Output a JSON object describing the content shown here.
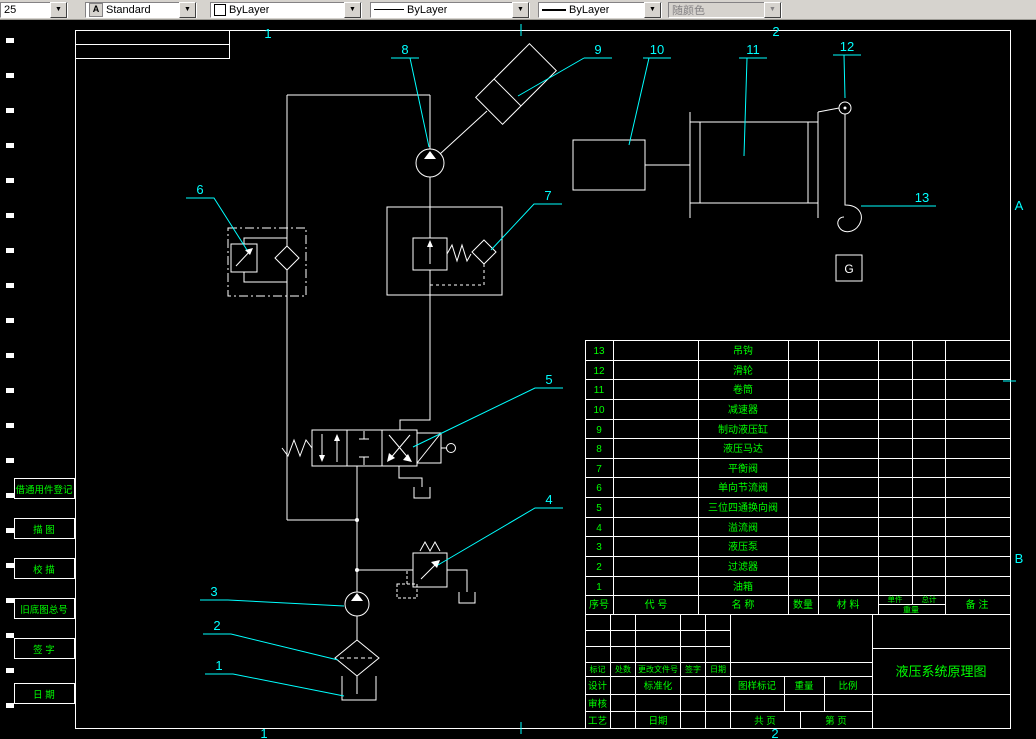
{
  "toolbar": {
    "layer_combo_value": "25",
    "style_combo_value": "Standard",
    "color_combo_value": "ByLayer",
    "linetype_combo_value": "ByLayer",
    "lineweight_combo_value": "ByLayer",
    "plotstyle_combo_value": "随颜色"
  },
  "icons": {
    "dropdown_arrow": "▼",
    "text_style": "A"
  },
  "colors": {
    "line": "#ffffff",
    "annotation": "#00ffff",
    "text": "#00ff00",
    "canvas": "#000000",
    "toolbar_bg": "#d6d3ce"
  },
  "zones": {
    "t1": "1",
    "t2": "2",
    "b1": "1",
    "b2": "2",
    "ra": "A",
    "rb": "B"
  },
  "margin_labels": [
    "借通用件登记",
    "描 图",
    "校 描",
    "旧底图总号",
    "签 字",
    "日 期"
  ],
  "callouts": [
    "1",
    "2",
    "3",
    "4",
    "5",
    "6",
    "7",
    "8",
    "9",
    "10",
    "11",
    "12",
    "13"
  ],
  "schematic": {
    "weight_label": "G"
  },
  "parts_table": {
    "headers": {
      "no": "序号",
      "code": "代 号",
      "name": "名 称",
      "qty": "数量",
      "material": "材 料",
      "unit": "单件",
      "total": "总计",
      "weight": "重量",
      "remarks": "备 注"
    },
    "rows": [
      {
        "no": "13",
        "name": "吊钩"
      },
      {
        "no": "12",
        "name": "滑轮"
      },
      {
        "no": "11",
        "name": "卷筒"
      },
      {
        "no": "10",
        "name": "减速器"
      },
      {
        "no": "9",
        "name": "制动液压缸"
      },
      {
        "no": "8",
        "name": "液压马达"
      },
      {
        "no": "7",
        "name": "平衡阀"
      },
      {
        "no": "6",
        "name": "单向节流阀"
      },
      {
        "no": "5",
        "name": "三位四通换向阀"
      },
      {
        "no": "4",
        "name": "溢流阀"
      },
      {
        "no": "3",
        "name": "液压泵"
      },
      {
        "no": "2",
        "name": "过滤器"
      },
      {
        "no": "1",
        "name": "油箱"
      }
    ]
  },
  "title_block": {
    "mark": "标记",
    "count": "处数",
    "change_doc": "更改文件号",
    "sign": "签字",
    "date": "日期",
    "design": "设计",
    "standardization": "标准化",
    "audit": "审核",
    "process": "工艺",
    "process_date": "日期",
    "drawing_mark": "图样标记",
    "weight": "重量",
    "scale": "比例",
    "sheets_total": "共  页",
    "sheet_no": "第  页",
    "title": "液压系统原理图"
  }
}
